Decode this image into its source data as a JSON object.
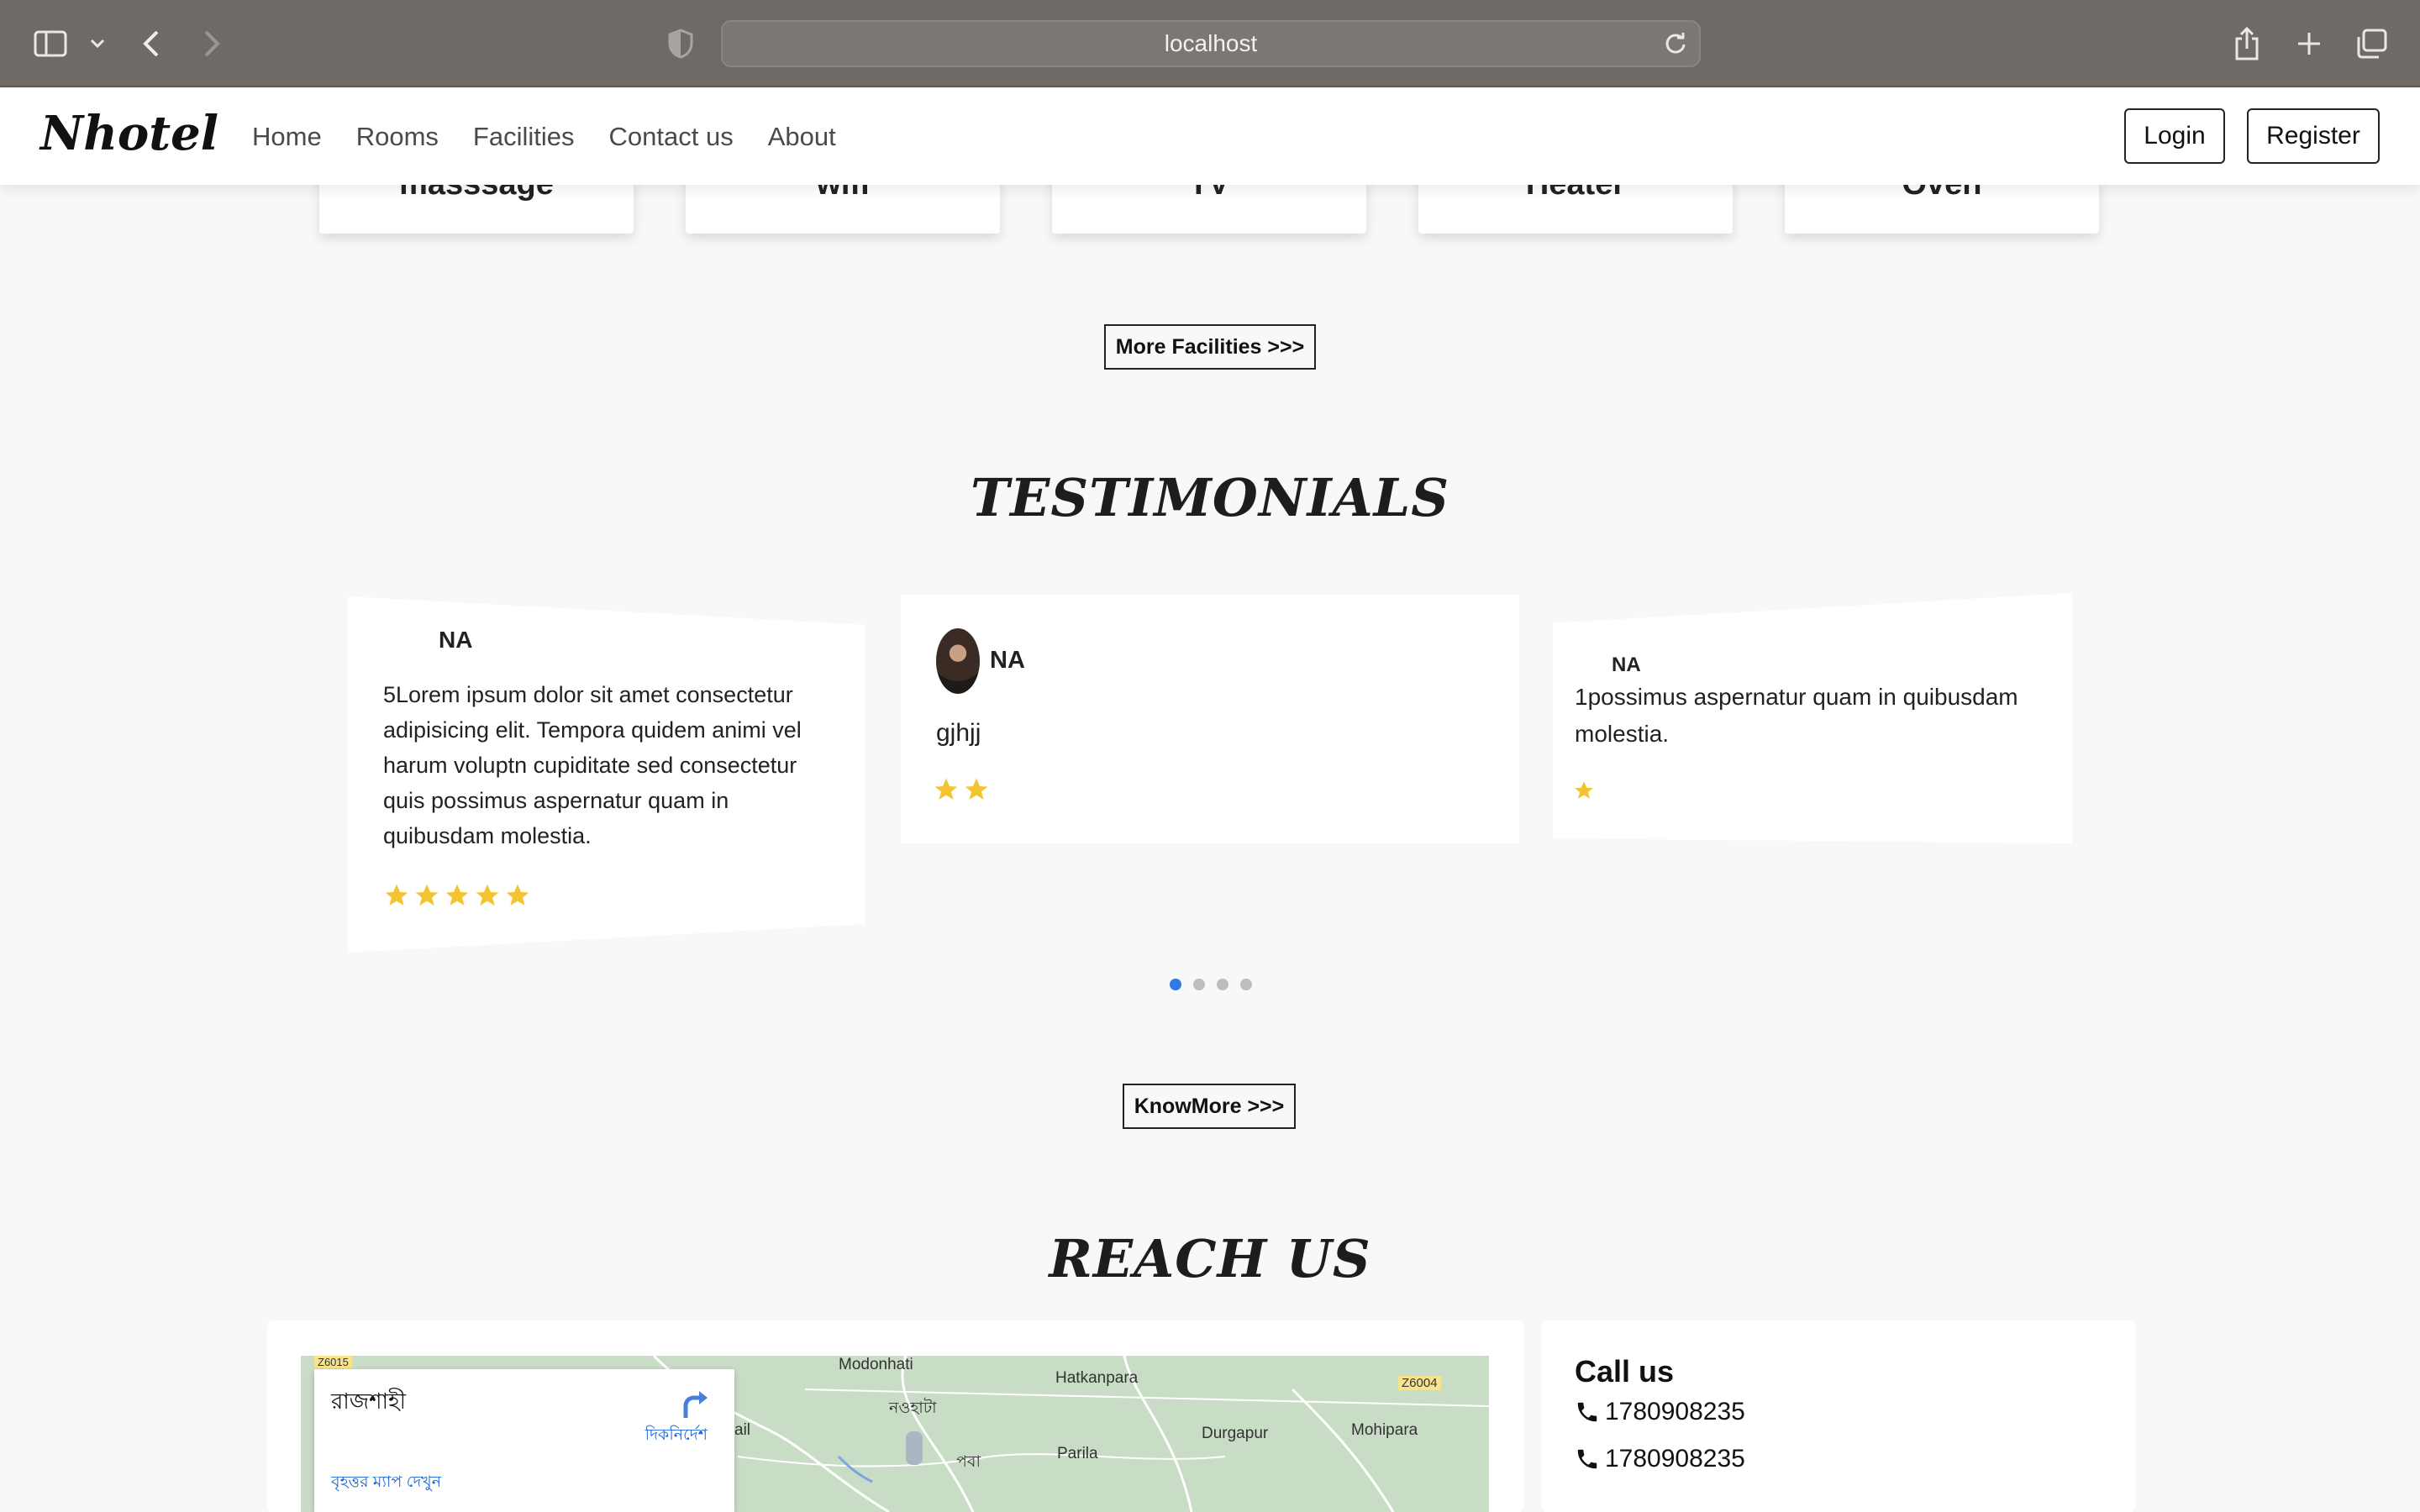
{
  "browser": {
    "url": "localhost"
  },
  "navbar": {
    "brand": "Nhotel",
    "links": [
      "Home",
      "Rooms",
      "Facilities",
      "Contact us",
      "About"
    ],
    "login_label": "Login",
    "register_label": "Register"
  },
  "facilities": {
    "cards": [
      "masssage",
      "wifi",
      "TV",
      "Heater",
      "Oven"
    ],
    "more_label": "More Facilities >>>"
  },
  "testimonials": {
    "title": "TESTIMONIALS",
    "cards": [
      {
        "name": "NA",
        "text": "5Lorem ipsum dolor sit amet consectetur adipisicing elit. Tempora quidem animi vel harum voluptn cupiditate sed consectetur quis possimus aspernatur quam in quibusdam molestia.",
        "rating": 5
      },
      {
        "name": "NA",
        "text": "gjhjj",
        "rating": 2
      },
      {
        "name": "NA",
        "text": "1possimus aspernatur quam in quibusdam molestia.",
        "rating": 1
      }
    ],
    "slide_count": 4,
    "active_slide": 1,
    "knowmore_label": "KnowMore >>>"
  },
  "reach": {
    "title": "REACH US",
    "map": {
      "place": "রাজশাহী",
      "directions": "দিকনির্দেশ",
      "larger_map": "বৃহত্তর ম্যাপ দেখুন",
      "labels": [
        "Modonhati",
        "Hatkanpara",
        "নওহাটা",
        "Parila",
        "Durgapur",
        "Mohipara",
        "পবা",
        "Z6004",
        "Z6015",
        "ail"
      ]
    },
    "call_title": "Call us",
    "phones": [
      "1780908235",
      "1780908235"
    ]
  },
  "colors": {
    "star": "#f4c430",
    "accent": "#2f7ae5"
  }
}
